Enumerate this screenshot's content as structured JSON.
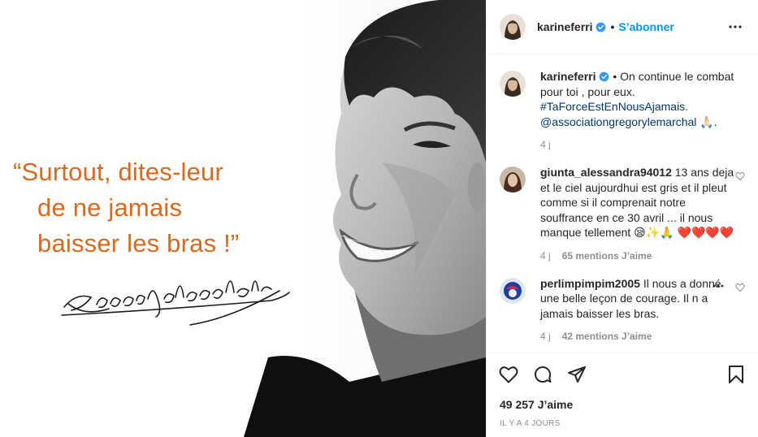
{
  "post": {
    "author": "karineferri",
    "follow_label": "S’abonner",
    "separator": "•",
    "image": {
      "quote_lines": [
        "“Surtout, dites-leur",
        "de ne jamais",
        "baisser les bras !”"
      ],
      "signature_text": "GregoryLemarchal"
    }
  },
  "caption": {
    "username": "karineferri",
    "text": " • On continue le combat pour toi , pour eux. ",
    "hashtag": "#TaForceEstEnNousAjamais.",
    "mention": "@associationgregorylemarchal",
    "emoji": " 🙏🏻.",
    "time": "4 j"
  },
  "comments": [
    {
      "username": "giunta_alessandra94012",
      "text": " 13 ans deja et le ciel aujourdhui est gris et il pleut comme si il comprenait notre souffrance en ce 30 avril ... il nous manque tellement 😪✨🙏 ❤️❤️❤️❤️",
      "time": "4 j",
      "likes": "65 mentions J’aime"
    },
    {
      "username": "perlimpimpim2005",
      "text": " Il nous a donné une belle leçon de courage. Il n a jamais baisser les bras.",
      "time": "4 j",
      "likes": "42 mentions J’aime"
    }
  ],
  "likes_count": "49 257 J’aime",
  "posted_ago": "Il y a 4 jours",
  "colors": {
    "accent": "#0095f6",
    "quote": "#d9691f",
    "link": "#00376b",
    "muted": "#8e8e8e"
  }
}
